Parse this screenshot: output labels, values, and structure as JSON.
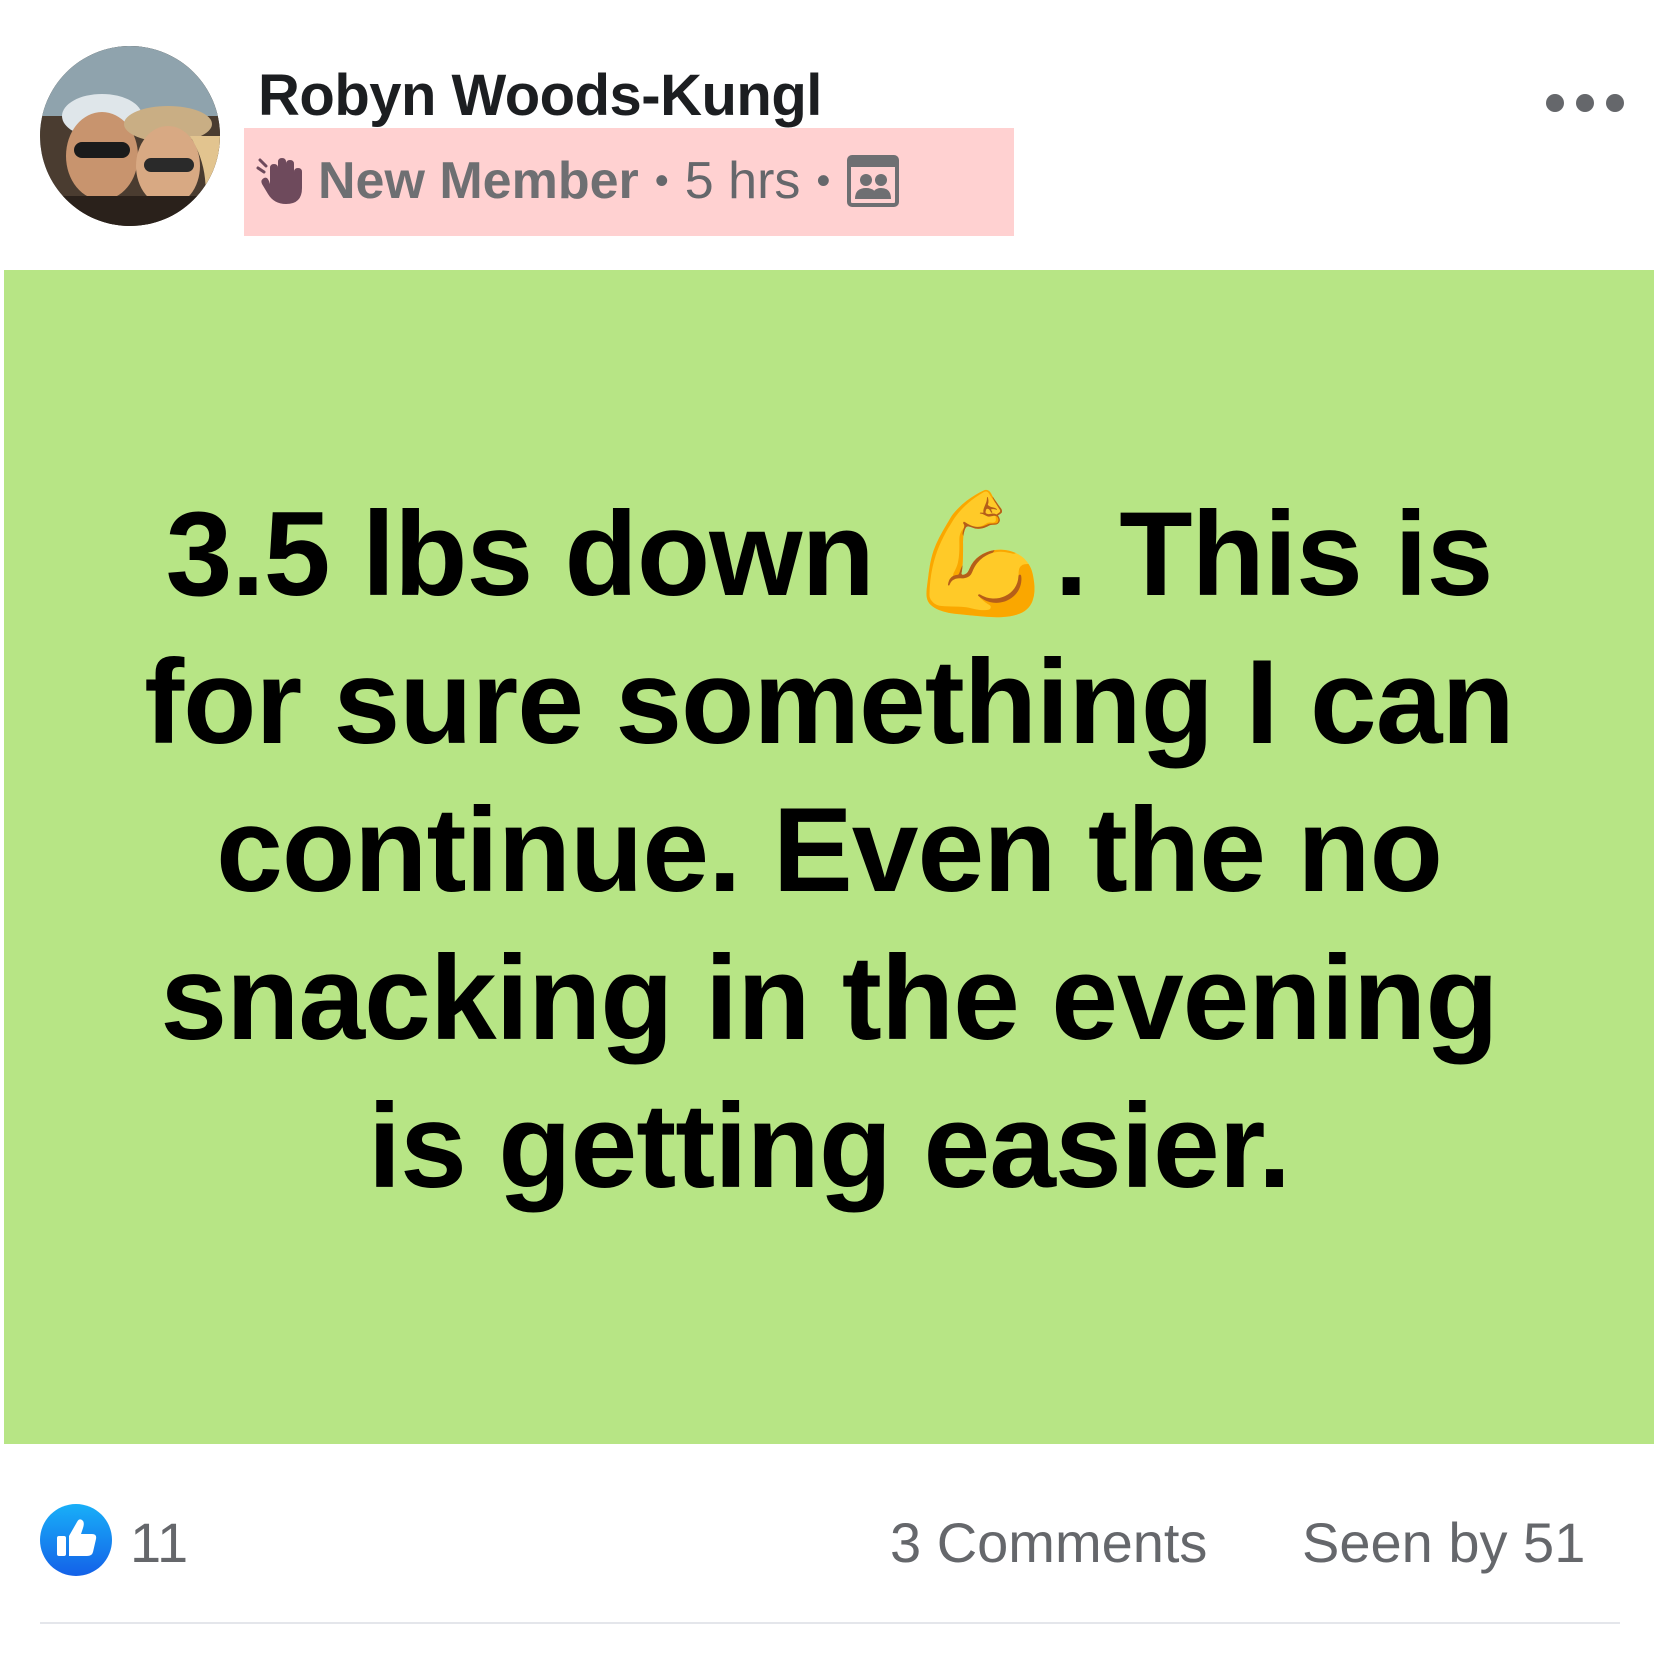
{
  "post": {
    "author": "Robyn Woods-Kungl",
    "badge": "New Member",
    "time": "5 hrs",
    "body_text": "3.5 lbs down 💪. This is for sure something I can continue. Even the no snacking in the evening is getting easier.",
    "background_color": "#b7e585"
  },
  "footer": {
    "like_count": "11",
    "comments": "3 Comments",
    "seen_by": "Seen by 51"
  },
  "icons": {
    "wave": "waving-hand-icon",
    "audience": "group-audience-icon",
    "more": "more-options-icon",
    "like": "like-thumbs-up-icon"
  },
  "colors": {
    "meta_highlight": "#ffd1d1",
    "like_blue": "#1877f2",
    "secondary_text": "#65676b"
  }
}
